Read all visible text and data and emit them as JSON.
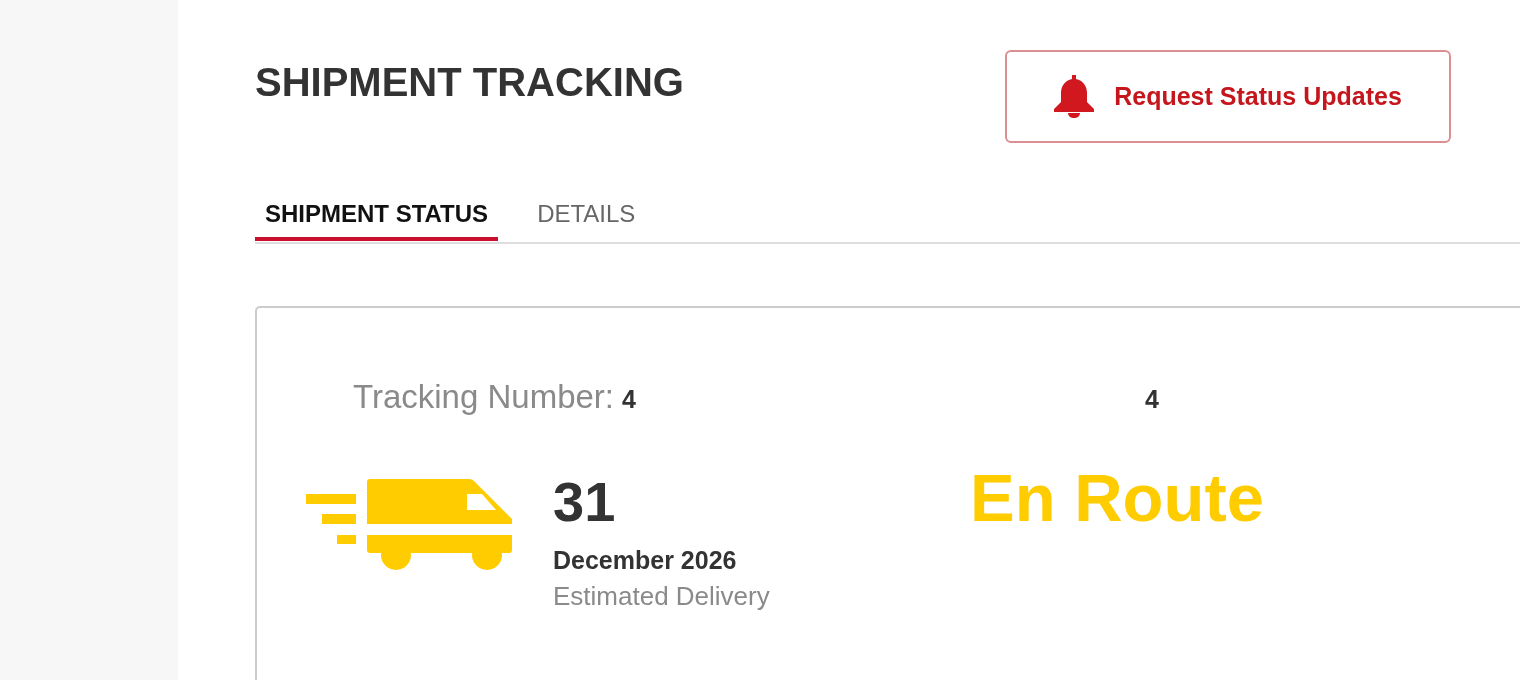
{
  "page": {
    "title": "SHIPMENT TRACKING",
    "action_button": {
      "label": "Request Status Updates"
    }
  },
  "tabs": [
    {
      "label": "SHIPMENT STATUS",
      "selected": true
    },
    {
      "label": "DETAILS",
      "selected": false
    }
  ],
  "status_card": {
    "tracking": {
      "label": "Tracking Number:",
      "value_parts": [
        "4",
        "4"
      ]
    },
    "delivery": {
      "day": "31",
      "month_year": "December 2026",
      "caption": "Estimated Delivery"
    },
    "status": "En Route"
  }
}
